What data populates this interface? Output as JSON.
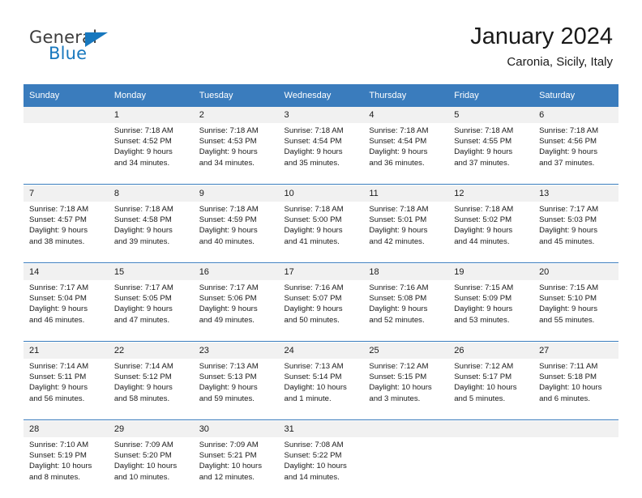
{
  "brand": {
    "name_part1": "General",
    "name_part2": "Blue"
  },
  "header": {
    "title": "January 2024",
    "subtitle": "Caronia, Sicily, Italy"
  },
  "colors": {
    "header_blue": "#3a7cbd",
    "brand_blue": "#1878be",
    "daynum_band": "#f1f1f1"
  },
  "calendar": {
    "day_names": [
      "Sunday",
      "Monday",
      "Tuesday",
      "Wednesday",
      "Thursday",
      "Friday",
      "Saturday"
    ],
    "weeks": [
      {
        "days": [
          {
            "num": "",
            "sunrise": "",
            "sunset": "",
            "daylight_a": "",
            "daylight_b": ""
          },
          {
            "num": "1",
            "sunrise": "Sunrise: 7:18 AM",
            "sunset": "Sunset: 4:52 PM",
            "daylight_a": "Daylight: 9 hours",
            "daylight_b": "and 34 minutes."
          },
          {
            "num": "2",
            "sunrise": "Sunrise: 7:18 AM",
            "sunset": "Sunset: 4:53 PM",
            "daylight_a": "Daylight: 9 hours",
            "daylight_b": "and 34 minutes."
          },
          {
            "num": "3",
            "sunrise": "Sunrise: 7:18 AM",
            "sunset": "Sunset: 4:54 PM",
            "daylight_a": "Daylight: 9 hours",
            "daylight_b": "and 35 minutes."
          },
          {
            "num": "4",
            "sunrise": "Sunrise: 7:18 AM",
            "sunset": "Sunset: 4:54 PM",
            "daylight_a": "Daylight: 9 hours",
            "daylight_b": "and 36 minutes."
          },
          {
            "num": "5",
            "sunrise": "Sunrise: 7:18 AM",
            "sunset": "Sunset: 4:55 PM",
            "daylight_a": "Daylight: 9 hours",
            "daylight_b": "and 37 minutes."
          },
          {
            "num": "6",
            "sunrise": "Sunrise: 7:18 AM",
            "sunset": "Sunset: 4:56 PM",
            "daylight_a": "Daylight: 9 hours",
            "daylight_b": "and 37 minutes."
          }
        ]
      },
      {
        "days": [
          {
            "num": "7",
            "sunrise": "Sunrise: 7:18 AM",
            "sunset": "Sunset: 4:57 PM",
            "daylight_a": "Daylight: 9 hours",
            "daylight_b": "and 38 minutes."
          },
          {
            "num": "8",
            "sunrise": "Sunrise: 7:18 AM",
            "sunset": "Sunset: 4:58 PM",
            "daylight_a": "Daylight: 9 hours",
            "daylight_b": "and 39 minutes."
          },
          {
            "num": "9",
            "sunrise": "Sunrise: 7:18 AM",
            "sunset": "Sunset: 4:59 PM",
            "daylight_a": "Daylight: 9 hours",
            "daylight_b": "and 40 minutes."
          },
          {
            "num": "10",
            "sunrise": "Sunrise: 7:18 AM",
            "sunset": "Sunset: 5:00 PM",
            "daylight_a": "Daylight: 9 hours",
            "daylight_b": "and 41 minutes."
          },
          {
            "num": "11",
            "sunrise": "Sunrise: 7:18 AM",
            "sunset": "Sunset: 5:01 PM",
            "daylight_a": "Daylight: 9 hours",
            "daylight_b": "and 42 minutes."
          },
          {
            "num": "12",
            "sunrise": "Sunrise: 7:18 AM",
            "sunset": "Sunset: 5:02 PM",
            "daylight_a": "Daylight: 9 hours",
            "daylight_b": "and 44 minutes."
          },
          {
            "num": "13",
            "sunrise": "Sunrise: 7:17 AM",
            "sunset": "Sunset: 5:03 PM",
            "daylight_a": "Daylight: 9 hours",
            "daylight_b": "and 45 minutes."
          }
        ]
      },
      {
        "days": [
          {
            "num": "14",
            "sunrise": "Sunrise: 7:17 AM",
            "sunset": "Sunset: 5:04 PM",
            "daylight_a": "Daylight: 9 hours",
            "daylight_b": "and 46 minutes."
          },
          {
            "num": "15",
            "sunrise": "Sunrise: 7:17 AM",
            "sunset": "Sunset: 5:05 PM",
            "daylight_a": "Daylight: 9 hours",
            "daylight_b": "and 47 minutes."
          },
          {
            "num": "16",
            "sunrise": "Sunrise: 7:17 AM",
            "sunset": "Sunset: 5:06 PM",
            "daylight_a": "Daylight: 9 hours",
            "daylight_b": "and 49 minutes."
          },
          {
            "num": "17",
            "sunrise": "Sunrise: 7:16 AM",
            "sunset": "Sunset: 5:07 PM",
            "daylight_a": "Daylight: 9 hours",
            "daylight_b": "and 50 minutes."
          },
          {
            "num": "18",
            "sunrise": "Sunrise: 7:16 AM",
            "sunset": "Sunset: 5:08 PM",
            "daylight_a": "Daylight: 9 hours",
            "daylight_b": "and 52 minutes."
          },
          {
            "num": "19",
            "sunrise": "Sunrise: 7:15 AM",
            "sunset": "Sunset: 5:09 PM",
            "daylight_a": "Daylight: 9 hours",
            "daylight_b": "and 53 minutes."
          },
          {
            "num": "20",
            "sunrise": "Sunrise: 7:15 AM",
            "sunset": "Sunset: 5:10 PM",
            "daylight_a": "Daylight: 9 hours",
            "daylight_b": "and 55 minutes."
          }
        ]
      },
      {
        "days": [
          {
            "num": "21",
            "sunrise": "Sunrise: 7:14 AM",
            "sunset": "Sunset: 5:11 PM",
            "daylight_a": "Daylight: 9 hours",
            "daylight_b": "and 56 minutes."
          },
          {
            "num": "22",
            "sunrise": "Sunrise: 7:14 AM",
            "sunset": "Sunset: 5:12 PM",
            "daylight_a": "Daylight: 9 hours",
            "daylight_b": "and 58 minutes."
          },
          {
            "num": "23",
            "sunrise": "Sunrise: 7:13 AM",
            "sunset": "Sunset: 5:13 PM",
            "daylight_a": "Daylight: 9 hours",
            "daylight_b": "and 59 minutes."
          },
          {
            "num": "24",
            "sunrise": "Sunrise: 7:13 AM",
            "sunset": "Sunset: 5:14 PM",
            "daylight_a": "Daylight: 10 hours",
            "daylight_b": "and 1 minute."
          },
          {
            "num": "25",
            "sunrise": "Sunrise: 7:12 AM",
            "sunset": "Sunset: 5:15 PM",
            "daylight_a": "Daylight: 10 hours",
            "daylight_b": "and 3 minutes."
          },
          {
            "num": "26",
            "sunrise": "Sunrise: 7:12 AM",
            "sunset": "Sunset: 5:17 PM",
            "daylight_a": "Daylight: 10 hours",
            "daylight_b": "and 5 minutes."
          },
          {
            "num": "27",
            "sunrise": "Sunrise: 7:11 AM",
            "sunset": "Sunset: 5:18 PM",
            "daylight_a": "Daylight: 10 hours",
            "daylight_b": "and 6 minutes."
          }
        ]
      },
      {
        "days": [
          {
            "num": "28",
            "sunrise": "Sunrise: 7:10 AM",
            "sunset": "Sunset: 5:19 PM",
            "daylight_a": "Daylight: 10 hours",
            "daylight_b": "and 8 minutes."
          },
          {
            "num": "29",
            "sunrise": "Sunrise: 7:09 AM",
            "sunset": "Sunset: 5:20 PM",
            "daylight_a": "Daylight: 10 hours",
            "daylight_b": "and 10 minutes."
          },
          {
            "num": "30",
            "sunrise": "Sunrise: 7:09 AM",
            "sunset": "Sunset: 5:21 PM",
            "daylight_a": "Daylight: 10 hours",
            "daylight_b": "and 12 minutes."
          },
          {
            "num": "31",
            "sunrise": "Sunrise: 7:08 AM",
            "sunset": "Sunset: 5:22 PM",
            "daylight_a": "Daylight: 10 hours",
            "daylight_b": "and 14 minutes."
          },
          {
            "num": "",
            "sunrise": "",
            "sunset": "",
            "daylight_a": "",
            "daylight_b": ""
          },
          {
            "num": "",
            "sunrise": "",
            "sunset": "",
            "daylight_a": "",
            "daylight_b": ""
          },
          {
            "num": "",
            "sunrise": "",
            "sunset": "",
            "daylight_a": "",
            "daylight_b": ""
          }
        ]
      }
    ]
  }
}
